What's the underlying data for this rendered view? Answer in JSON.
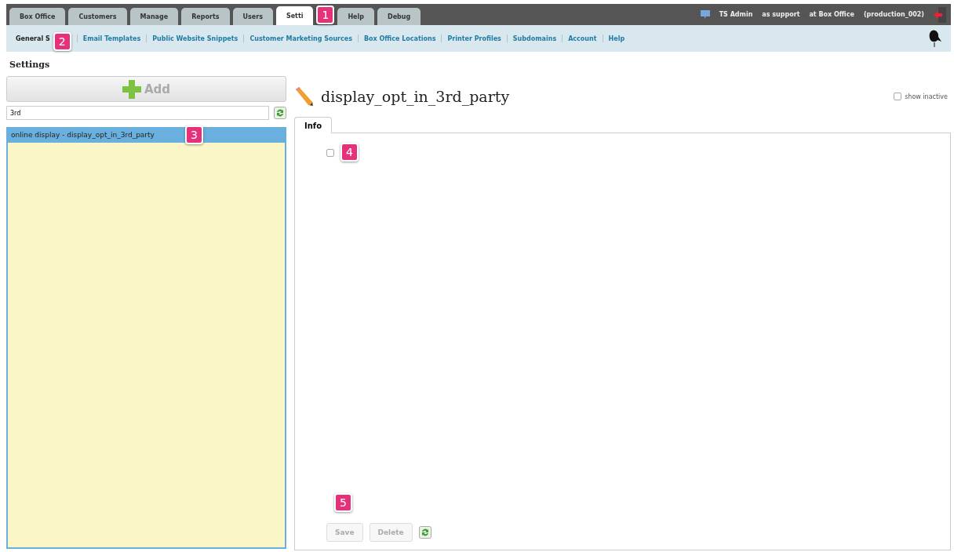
{
  "top_tabs": [
    {
      "label": "Box Office",
      "selected": false
    },
    {
      "label": "Customers",
      "selected": false
    },
    {
      "label": "Manage",
      "selected": false
    },
    {
      "label": "Reports",
      "selected": false
    },
    {
      "label": "Users",
      "selected": false
    },
    {
      "label": "Setti",
      "selected": true,
      "callout": "1"
    },
    {
      "label": "Help",
      "selected": false
    },
    {
      "label": "Debug",
      "selected": false
    }
  ],
  "user_info": [
    "TS Admin",
    "as support",
    "at Box Office",
    "(production_002)"
  ],
  "sub_nav": [
    {
      "label": "General S",
      "selected": true,
      "callout": "2"
    },
    {
      "label": "Email Templates",
      "selected": false
    },
    {
      "label": "Public Website Snippets",
      "selected": false
    },
    {
      "label": "Customer Marketing Sources",
      "selected": false
    },
    {
      "label": "Box Office Locations",
      "selected": false
    },
    {
      "label": "Printer Profiles",
      "selected": false
    },
    {
      "label": "Subdomains",
      "selected": false
    },
    {
      "label": "Account",
      "selected": false
    },
    {
      "label": "Help",
      "selected": false
    }
  ],
  "page_title": "Settings",
  "sidebar": {
    "add_button": "Add",
    "search": {
      "value": "3rd"
    },
    "items": [
      {
        "label": "online display - display_opt_in_3rd_party",
        "selected": true,
        "callout": "3"
      }
    ]
  },
  "detail": {
    "title": "display_opt_in_3rd_party",
    "show_inactive": {
      "label": "show inactive",
      "checked": false
    },
    "tabs": [
      {
        "label": "Info",
        "selected": true
      }
    ],
    "checkbox": {
      "checked": false,
      "callout": "4"
    },
    "buttons_callout": "5",
    "buttons": [
      {
        "label": "Save",
        "disabled": true
      },
      {
        "label": "Delete",
        "disabled": true
      }
    ]
  }
}
